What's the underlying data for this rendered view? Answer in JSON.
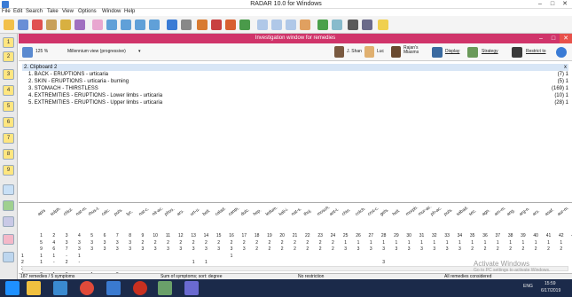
{
  "window": {
    "title": "RADAR 10.0 for Windows",
    "min": "–",
    "max": "□",
    "close": "✕"
  },
  "menu": [
    "File",
    "Edit",
    "Search",
    "Take",
    "View",
    "Options",
    "Window",
    "Help"
  ],
  "inner_window": {
    "title": "Investigation window for remedies",
    "close_glyph": "✕",
    "max_glyph": "□",
    "min_glyph": "–"
  },
  "inner_toolbar": {
    "zoom": "125 %",
    "view": "Millennium view (progressive)",
    "shan": "J. Shan",
    "luc": "Luc",
    "rajan": "Rajan's Miasms",
    "display": "Display",
    "strategy": "Strategy",
    "restrict": "Restrict to"
  },
  "clipboard": {
    "title": "2. Clipboard 2",
    "close": "x",
    "rubrics": [
      {
        "label": "1. BACK - ERUPTIONS - urticaria",
        "count": "(7) 1"
      },
      {
        "label": "2. SKIN - ERUPTIONS - urticaria - burning",
        "count": "(5) 1"
      },
      {
        "label": "3. STOMACH - THIRSTLESS",
        "count": "(169) 1"
      },
      {
        "label": "4. EXTREMITIES - ERUPTIONS - Lower limbs - urticaria",
        "count": "(10) 1"
      },
      {
        "label": "5. EXTREMITIES - ERUPTIONS - Upper limbs - urticaria",
        "count": "(28) 1"
      }
    ]
  },
  "remedies": [
    "apis",
    "sulph.",
    "chlol.",
    "nat-m.",
    "rhus-t.",
    "calc.",
    "puls.",
    "lyc.",
    "nat-c.",
    "nit-ac.",
    "phos.",
    "ars.",
    "urt-u.",
    "bell.",
    "calad.",
    "canth.",
    "dulc.",
    "hep.",
    "ledum.",
    "kali-i.",
    "nat-s.",
    "thuj.",
    "mosch.",
    "ant-t.",
    "chin.",
    "colch.",
    "crot-c.",
    "gels.",
    "hell.",
    "morph.",
    "mur-ac.",
    "ph-ac.",
    "puls.",
    "sabad.",
    "sec.",
    "agn.",
    "am-m.",
    "ang.",
    "arg-n.",
    "ars.",
    "asaf.",
    "aur-m."
  ],
  "row_nums": [
    "1",
    "2",
    "3",
    "4",
    "5",
    "6",
    "7",
    "8",
    "9",
    "10",
    "11",
    "12",
    "13",
    "14",
    "15",
    "16",
    "17",
    "18",
    "19",
    "20",
    "21",
    "22",
    "23",
    "24",
    "25",
    "26",
    "27",
    "28",
    "29",
    "30",
    "31",
    "32",
    "33",
    "34",
    "35",
    "36",
    "37",
    "38",
    "39",
    "40",
    "41",
    "42",
    "43"
  ],
  "row_sym": [
    "5",
    "4",
    "3",
    "3",
    "3",
    "3",
    "3",
    "3",
    "2",
    "2",
    "2",
    "2",
    "2",
    "2",
    "2",
    "2",
    "2",
    "2",
    "2",
    "2",
    "2",
    "2",
    "2",
    "2",
    "1",
    "1",
    "1",
    "1",
    "1",
    "1",
    "1",
    "1",
    "1",
    "1",
    "1",
    "1",
    "1",
    "1",
    "1",
    "1",
    "1",
    "1",
    "1"
  ],
  "row_deg": [
    "9",
    "6",
    "7",
    "3",
    "3",
    "3",
    "3",
    "3",
    "3",
    "3",
    "3",
    "3",
    "3",
    "3",
    "3",
    "3",
    "3",
    "2",
    "2",
    "2",
    "2",
    "2",
    "2",
    "2",
    "3",
    "3",
    "3",
    "3",
    "3",
    "3",
    "3",
    "3",
    "3",
    "3",
    "2",
    "2",
    "2",
    "2",
    "2",
    "2",
    "2",
    "2",
    "2"
  ],
  "grid_rows": [
    {
      "n": "1",
      "vals": [
        "1",
        "1",
        "-",
        "1",
        "",
        "",
        "",
        "",
        "",
        "",
        "",
        "",
        "",
        "",
        "",
        "1",
        "",
        "",
        "",
        "",
        "",
        "",
        "",
        "",
        "",
        "",
        "",
        "",
        "",
        "",
        "",
        "",
        "",
        "",
        "",
        "",
        "",
        "",
        "",
        "",
        "",
        "",
        ""
      ]
    },
    {
      "n": "2",
      "vals": [
        "1",
        "-",
        "2",
        "-",
        "",
        "",
        "",
        "",
        "",
        "",
        "",
        "",
        "1",
        "1",
        "",
        "",
        "",
        "",
        "",
        "",
        "",
        "",
        "",
        "",
        "",
        "",
        "",
        "3",
        "",
        "",
        "",
        "",
        "",
        "",
        "",
        "",
        "",
        "",
        "",
        "",
        "",
        "",
        ""
      ]
    },
    {
      "n": "3",
      "vals": [
        "3",
        "1",
        "-",
        "1",
        "1",
        "2",
        "1",
        "1",
        "2",
        "1",
        "1",
        "1",
        "2",
        "-",
        "1",
        "1",
        "1",
        "1",
        "-",
        "1",
        "1",
        "1",
        "3",
        "3",
        "3",
        "-",
        "3",
        "3",
        "3",
        "3",
        "3",
        "3",
        "3",
        "2",
        "2",
        "2",
        "2",
        "2",
        "2",
        "2",
        "2",
        "2",
        "2"
      ]
    },
    {
      "n": "4",
      "vals": [
        "2",
        "1",
        "3",
        "-",
        "1",
        "-",
        "2",
        "-",
        "",
        "",
        "",
        "",
        "",
        "",
        "",
        "",
        "",
        "",
        "",
        "",
        "",
        "",
        "",
        "",
        "",
        "",
        "",
        "",
        "",
        "",
        "",
        "",
        "",
        "",
        "",
        "",
        "",
        "",
        "",
        "",
        "",
        "",
        ""
      ]
    },
    {
      "n": "5",
      "vals": [
        "1",
        "2",
        "1",
        "1",
        "1",
        "-",
        "2",
        "1",
        "2",
        "2",
        "2",
        "-",
        "2",
        "1",
        "1",
        "1",
        "1",
        "1",
        "-",
        "1",
        "1",
        "",
        "",
        "",
        "",
        "",
        "",
        "",
        "",
        "",
        "",
        "",
        "",
        "",
        "",
        "",
        "",
        "",
        "",
        "",
        "",
        "",
        ""
      ]
    }
  ],
  "status": {
    "left": "187 remedies / 5 symptoms",
    "mid": "Sum of symptoms; sort: degree",
    "right": "No restriction",
    "far": "All remedies considered"
  },
  "watermark": {
    "line1": "Activate Windows",
    "line2": "Go to PC settings to activate Windows."
  },
  "taskbar": {
    "time": "15:59",
    "date": "6/17/2019",
    "lang": "ENG"
  },
  "icons": [
    "app-icon",
    "radar-icon",
    "search-icon",
    "folder-icon",
    "chart-icon"
  ],
  "colors": {
    "inner_title": "#d0346a",
    "clip_header": "#d8e6f6",
    "taskbar": "#1b2a4a"
  }
}
